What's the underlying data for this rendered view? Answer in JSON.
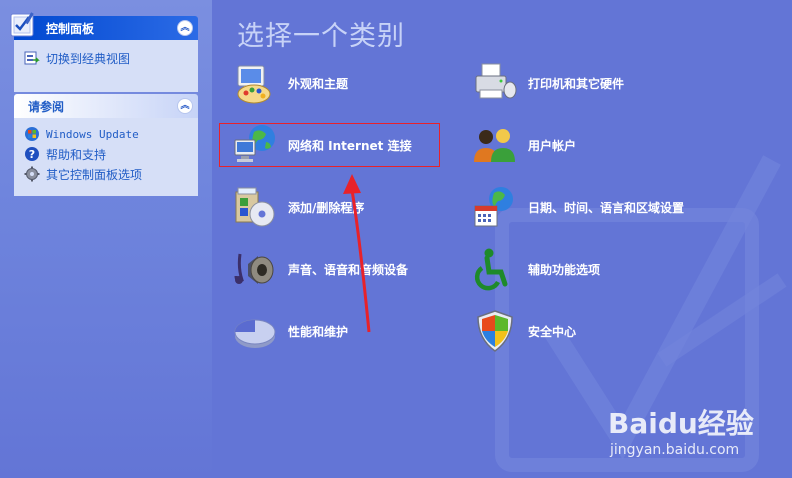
{
  "sidebar": {
    "control_panel": {
      "title": "控制面板",
      "switch_label": "切换到经典视图"
    },
    "see_also": {
      "title": "请参阅",
      "items": [
        {
          "label": "Windows Update",
          "icon": "windows-update-icon"
        },
        {
          "label": "帮助和支持",
          "icon": "help-icon"
        },
        {
          "label": "其它控制面板选项",
          "icon": "gear-icon"
        }
      ]
    }
  },
  "main": {
    "title": "选择一个类别",
    "categories": [
      {
        "label": "外观和主题",
        "icon": "appearance-palette-icon"
      },
      {
        "label": "打印机和其它硬件",
        "icon": "printer-icon"
      },
      {
        "label": "网络和 Internet 连接",
        "icon": "network-globe-icon"
      },
      {
        "label": "用户帐户",
        "icon": "users-icon"
      },
      {
        "label": "添加/删除程序",
        "icon": "add-remove-programs-icon"
      },
      {
        "label": "日期、时间、语言和区域设置",
        "icon": "date-globe-icon"
      },
      {
        "label": "声音、语音和音频设备",
        "icon": "speaker-icon"
      },
      {
        "label": "辅助功能选项",
        "icon": "accessibility-icon"
      },
      {
        "label": "性能和维护",
        "icon": "performance-pie-icon"
      },
      {
        "label": "安全中心",
        "icon": "security-shield-icon"
      }
    ]
  },
  "watermark": {
    "brand": "Baidu经验",
    "url": "jingyan.baidu.com"
  },
  "colors": {
    "background": "#6375d6",
    "highlight": "#e8222a",
    "link": "#215dc6"
  }
}
